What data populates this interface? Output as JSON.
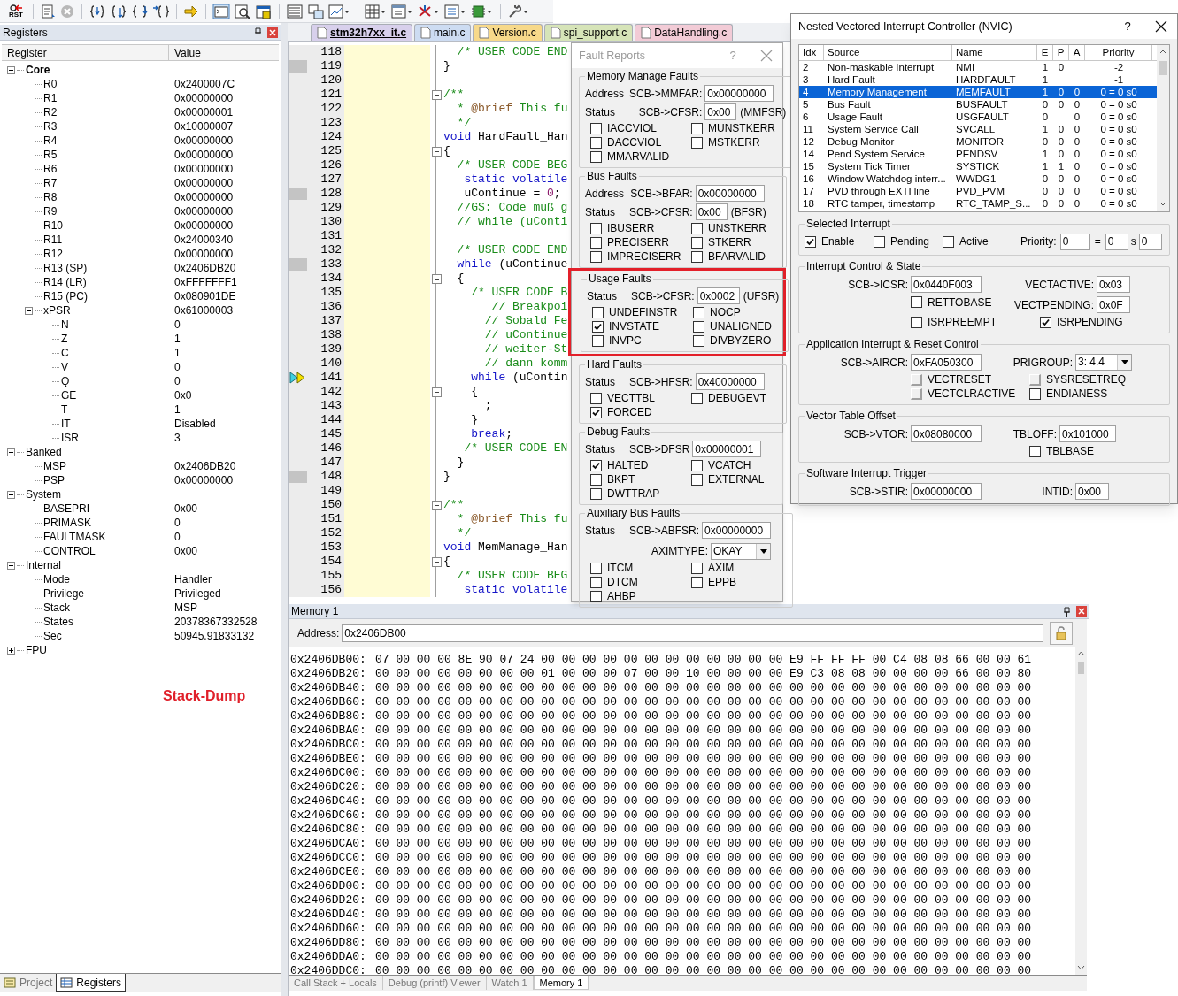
{
  "toolbar": {
    "reset_label": "RST"
  },
  "registers_panel": {
    "title": "Registers",
    "columns": [
      "Register",
      "Value"
    ],
    "tree": [
      {
        "name": "Core",
        "emphasized": true,
        "expanded": true,
        "children": [
          {
            "name": "R0",
            "value": "0x2400007C"
          },
          {
            "name": "R1",
            "value": "0x00000000"
          },
          {
            "name": "R2",
            "value": "0x00000001"
          },
          {
            "name": "R3",
            "value": "0x10000007"
          },
          {
            "name": "R4",
            "value": "0x00000000"
          },
          {
            "name": "R5",
            "value": "0x00000000"
          },
          {
            "name": "R6",
            "value": "0x00000000"
          },
          {
            "name": "R7",
            "value": "0x00000000"
          },
          {
            "name": "R8",
            "value": "0x00000000"
          },
          {
            "name": "R9",
            "value": "0x00000000"
          },
          {
            "name": "R10",
            "value": "0x00000000"
          },
          {
            "name": "R11",
            "value": "0x24000340"
          },
          {
            "name": "R12",
            "value": "0x00000000"
          },
          {
            "name": "R13 (SP)",
            "value": "0x2406DB20"
          },
          {
            "name": "R14 (LR)",
            "value": "0xFFFFFFF1"
          },
          {
            "name": "R15 (PC)",
            "value": "0x080901DE"
          },
          {
            "name": "xPSR",
            "value": "0x61000003",
            "expanded": true,
            "children": [
              {
                "name": "N",
                "value": "0"
              },
              {
                "name": "Z",
                "value": "1"
              },
              {
                "name": "C",
                "value": "1"
              },
              {
                "name": "V",
                "value": "0"
              },
              {
                "name": "Q",
                "value": "0"
              },
              {
                "name": "GE",
                "value": "0x0"
              },
              {
                "name": "T",
                "value": "1"
              },
              {
                "name": "IT",
                "value": "Disabled"
              },
              {
                "name": "ISR",
                "value": "3"
              }
            ]
          }
        ]
      },
      {
        "name": "Banked",
        "emphasized": false,
        "expanded": true,
        "children": [
          {
            "name": "MSP",
            "value": "0x2406DB20"
          },
          {
            "name": "PSP",
            "value": "0x00000000"
          }
        ]
      },
      {
        "name": "System",
        "emphasized": false,
        "expanded": true,
        "children": [
          {
            "name": "BASEPRI",
            "value": "0x00"
          },
          {
            "name": "PRIMASK",
            "value": "0"
          },
          {
            "name": "FAULTMASK",
            "value": "0"
          },
          {
            "name": "CONTROL",
            "value": "0x00"
          }
        ]
      },
      {
        "name": "Internal",
        "emphasized": false,
        "expanded": true,
        "children": [
          {
            "name": "Mode",
            "value": "Handler"
          },
          {
            "name": "Privilege",
            "value": "Privileged"
          },
          {
            "name": "Stack",
            "value": "MSP"
          },
          {
            "name": "States",
            "value": "20378367332528"
          },
          {
            "name": "Sec",
            "value": "50945.91833132"
          }
        ]
      },
      {
        "name": "FPU",
        "emphasized": false,
        "expanded": false
      }
    ],
    "annotation": "Stack-Dump",
    "tabs": [
      {
        "label": "Project",
        "selected": false
      },
      {
        "label": "Registers",
        "selected": true
      }
    ]
  },
  "editor": {
    "tabs": [
      {
        "label": "stm32h7xx_it.c",
        "selected": true,
        "color": "#d8d0ec"
      },
      {
        "label": "main.c",
        "selected": false,
        "color": "#cddcf2"
      },
      {
        "label": "Version.c",
        "selected": false,
        "color": "#f7d98a"
      },
      {
        "label": "spi_support.c",
        "selected": false,
        "color": "#d6e4b8"
      },
      {
        "label": "DataHandling.c",
        "selected": false,
        "color": "#f2cbd6"
      }
    ],
    "lines": [
      {
        "number": "118",
        "marked": false,
        "fold": false,
        "current": false,
        "segments": [
          {
            "kind": "comment",
            "text": "  /* USER CODE END"
          }
        ]
      },
      {
        "number": "119",
        "marked": true,
        "fold": false,
        "current": false,
        "segments": [
          {
            "kind": "plain",
            "text": "}"
          }
        ]
      },
      {
        "number": "120",
        "marked": false,
        "fold": false,
        "current": false
      },
      {
        "number": "121",
        "marked": false,
        "fold": true,
        "current": false,
        "segments": [
          {
            "kind": "comment",
            "text": "/**"
          }
        ]
      },
      {
        "number": "122",
        "marked": false,
        "fold": false,
        "current": false,
        "segments": [
          {
            "kind": "comment",
            "text": "  * "
          },
          {
            "kind": "tag",
            "text": "@brief"
          },
          {
            "kind": "comment",
            "text": " This fu"
          }
        ]
      },
      {
        "number": "123",
        "marked": false,
        "fold": false,
        "current": false,
        "segments": [
          {
            "kind": "comment",
            "text": "  */"
          }
        ]
      },
      {
        "number": "124",
        "marked": false,
        "fold": false,
        "current": false,
        "segments": [
          {
            "kind": "keyword",
            "text": "void"
          },
          {
            "kind": "plain",
            "text": " HardFault_Han"
          }
        ]
      },
      {
        "number": "125",
        "marked": false,
        "fold": true,
        "current": false,
        "segments": [
          {
            "kind": "plain",
            "text": "{"
          }
        ]
      },
      {
        "number": "126",
        "marked": false,
        "fold": false,
        "current": false,
        "segments": [
          {
            "kind": "comment",
            "text": "  /* USER CODE BEG"
          }
        ]
      },
      {
        "number": "127",
        "marked": false,
        "fold": false,
        "current": false,
        "segments": [
          {
            "kind": "keyword",
            "text": "   static volatile"
          }
        ]
      },
      {
        "number": "128",
        "marked": true,
        "fold": false,
        "current": false,
        "segments": [
          {
            "kind": "plain",
            "text": "   uContinue = "
          },
          {
            "kind": "number",
            "text": "0"
          },
          {
            "kind": "plain",
            "text": ";"
          }
        ]
      },
      {
        "number": "129",
        "marked": false,
        "fold": false,
        "current": false,
        "segments": [
          {
            "kind": "comment",
            "text": "  //GS: Code muß g"
          }
        ]
      },
      {
        "number": "130",
        "marked": false,
        "fold": false,
        "current": false,
        "segments": [
          {
            "kind": "comment",
            "text": "  // while (uConti"
          }
        ]
      },
      {
        "number": "131",
        "marked": false,
        "fold": false,
        "current": false
      },
      {
        "number": "132",
        "marked": false,
        "fold": false,
        "current": false,
        "segments": [
          {
            "kind": "comment",
            "text": "  /* USER CODE END"
          }
        ]
      },
      {
        "number": "133",
        "marked": true,
        "fold": false,
        "current": false,
        "segments": [
          {
            "kind": "keyword",
            "text": "  while"
          },
          {
            "kind": "plain",
            "text": " (uContinue"
          }
        ]
      },
      {
        "number": "134",
        "marked": false,
        "fold": true,
        "current": false,
        "segments": [
          {
            "kind": "plain",
            "text": "  {"
          }
        ]
      },
      {
        "number": "135",
        "marked": false,
        "fold": false,
        "current": false,
        "segments": [
          {
            "kind": "comment",
            "text": "    /* USER CODE B"
          }
        ]
      },
      {
        "number": "136",
        "marked": false,
        "fold": false,
        "current": false,
        "segments": [
          {
            "kind": "comment",
            "text": "       // Breakpoi"
          }
        ]
      },
      {
        "number": "137",
        "marked": false,
        "fold": false,
        "current": false,
        "segments": [
          {
            "kind": "comment",
            "text": "      // Sobald Fe"
          }
        ]
      },
      {
        "number": "138",
        "marked": false,
        "fold": false,
        "current": false,
        "segments": [
          {
            "kind": "comment",
            "text": "      // uContinue"
          }
        ]
      },
      {
        "number": "139",
        "marked": false,
        "fold": false,
        "current": false,
        "segments": [
          {
            "kind": "comment",
            "text": "      // weiter-St"
          }
        ]
      },
      {
        "number": "140",
        "marked": false,
        "fold": false,
        "current": false,
        "segments": [
          {
            "kind": "comment",
            "text": "      // dann komm"
          }
        ]
      },
      {
        "number": "141",
        "marked": false,
        "fold": false,
        "current": true,
        "segments": [
          {
            "kind": "keyword",
            "text": "    while"
          },
          {
            "kind": "plain",
            "text": " (uContin"
          }
        ]
      },
      {
        "number": "142",
        "marked": false,
        "fold": true,
        "current": false,
        "segments": [
          {
            "kind": "plain",
            "text": "    {"
          }
        ]
      },
      {
        "number": "143",
        "marked": false,
        "fold": false,
        "current": false,
        "segments": [
          {
            "kind": "plain",
            "text": "      ;"
          }
        ]
      },
      {
        "number": "144",
        "marked": false,
        "fold": false,
        "current": false,
        "segments": [
          {
            "kind": "plain",
            "text": "    }"
          }
        ]
      },
      {
        "number": "145",
        "marked": false,
        "fold": false,
        "current": false,
        "segments": [
          {
            "kind": "keyword",
            "text": "    break"
          },
          {
            "kind": "plain",
            "text": ";"
          }
        ]
      },
      {
        "number": "146",
        "marked": false,
        "fold": false,
        "current": false,
        "segments": [
          {
            "kind": "comment",
            "text": "   /* USER CODE EN"
          }
        ]
      },
      {
        "number": "147",
        "marked": false,
        "fold": false,
        "current": false,
        "segments": [
          {
            "kind": "plain",
            "text": "  }"
          }
        ]
      },
      {
        "number": "148",
        "marked": true,
        "fold": false,
        "current": false,
        "segments": [
          {
            "kind": "plain",
            "text": "}"
          }
        ]
      },
      {
        "number": "149",
        "marked": false,
        "fold": false,
        "current": false
      },
      {
        "number": "150",
        "marked": false,
        "fold": true,
        "current": false,
        "segments": [
          {
            "kind": "comment",
            "text": "/**"
          }
        ]
      },
      {
        "number": "151",
        "marked": false,
        "fold": false,
        "current": false,
        "segments": [
          {
            "kind": "comment",
            "text": "  * "
          },
          {
            "kind": "tag",
            "text": "@brief"
          },
          {
            "kind": "comment",
            "text": " This fu"
          }
        ]
      },
      {
        "number": "152",
        "marked": false,
        "fold": false,
        "current": false,
        "segments": [
          {
            "kind": "comment",
            "text": "  */"
          }
        ]
      },
      {
        "number": "153",
        "marked": false,
        "fold": false,
        "current": false,
        "segments": [
          {
            "kind": "keyword",
            "text": "void"
          },
          {
            "kind": "plain",
            "text": " MemManage_Han"
          }
        ]
      },
      {
        "number": "154",
        "marked": false,
        "fold": true,
        "current": false,
        "segments": [
          {
            "kind": "plain",
            "text": "{"
          }
        ]
      },
      {
        "number": "155",
        "marked": false,
        "fold": false,
        "current": false,
        "segments": [
          {
            "kind": "comment",
            "text": "  /* USER CODE BEG"
          }
        ]
      },
      {
        "number": "156",
        "marked": false,
        "fold": false,
        "current": false,
        "segments": [
          {
            "kind": "keyword",
            "text": "   static volatile"
          }
        ]
      }
    ]
  },
  "memory": {
    "title": "Memory 1",
    "address_label": "Address:",
    "address": "0x2406DB00",
    "rows": [
      {
        "address": "0x2406DB00:",
        "bytes": "07 00 00 00 8E 90 07 24 00 00 00 00 00 00 00 00 00 00 00 00 E9 FF FF FF 00 C4 08 08 66 00 00 61"
      },
      {
        "address": "0x2406DB20:",
        "bytes": "00 00 00 00 00 00 00 00 01 00 00 00 07 00 00 10 00 00 00 00 E9 C3 08 08 00 00 00 00 66 00 00 80"
      },
      {
        "address": "0x2406DB40:",
        "bytes": "00 00 00 00 00 00 00 00 00 00 00 00 00 00 00 00 00 00 00 00 00 00 00 00 00 00 00 00 00 00 00 00"
      },
      {
        "address": "0x2406DB60:",
        "bytes": "00 00 00 00 00 00 00 00 00 00 00 00 00 00 00 00 00 00 00 00 00 00 00 00 00 00 00 00 00 00 00 00"
      },
      {
        "address": "0x2406DB80:",
        "bytes": "00 00 00 00 00 00 00 00 00 00 00 00 00 00 00 00 00 00 00 00 00 00 00 00 00 00 00 00 00 00 00 00"
      },
      {
        "address": "0x2406DBA0:",
        "bytes": "00 00 00 00 00 00 00 00 00 00 00 00 00 00 00 00 00 00 00 00 00 00 00 00 00 00 00 00 00 00 00 00"
      },
      {
        "address": "0x2406DBC0:",
        "bytes": "00 00 00 00 00 00 00 00 00 00 00 00 00 00 00 00 00 00 00 00 00 00 00 00 00 00 00 00 00 00 00 00"
      },
      {
        "address": "0x2406DBE0:",
        "bytes": "00 00 00 00 00 00 00 00 00 00 00 00 00 00 00 00 00 00 00 00 00 00 00 00 00 00 00 00 00 00 00 00"
      },
      {
        "address": "0x2406DC00:",
        "bytes": "00 00 00 00 00 00 00 00 00 00 00 00 00 00 00 00 00 00 00 00 00 00 00 00 00 00 00 00 00 00 00 00"
      },
      {
        "address": "0x2406DC20:",
        "bytes": "00 00 00 00 00 00 00 00 00 00 00 00 00 00 00 00 00 00 00 00 00 00 00 00 00 00 00 00 00 00 00 00"
      },
      {
        "address": "0x2406DC40:",
        "bytes": "00 00 00 00 00 00 00 00 00 00 00 00 00 00 00 00 00 00 00 00 00 00 00 00 00 00 00 00 00 00 00 00"
      },
      {
        "address": "0x2406DC60:",
        "bytes": "00 00 00 00 00 00 00 00 00 00 00 00 00 00 00 00 00 00 00 00 00 00 00 00 00 00 00 00 00 00 00 00"
      },
      {
        "address": "0x2406DC80:",
        "bytes": "00 00 00 00 00 00 00 00 00 00 00 00 00 00 00 00 00 00 00 00 00 00 00 00 00 00 00 00 00 00 00 00"
      },
      {
        "address": "0x2406DCA0:",
        "bytes": "00 00 00 00 00 00 00 00 00 00 00 00 00 00 00 00 00 00 00 00 00 00 00 00 00 00 00 00 00 00 00 00"
      },
      {
        "address": "0x2406DCC0:",
        "bytes": "00 00 00 00 00 00 00 00 00 00 00 00 00 00 00 00 00 00 00 00 00 00 00 00 00 00 00 00 00 00 00 00"
      },
      {
        "address": "0x2406DCE0:",
        "bytes": "00 00 00 00 00 00 00 00 00 00 00 00 00 00 00 00 00 00 00 00 00 00 00 00 00 00 00 00 00 00 00 00"
      },
      {
        "address": "0x2406DD00:",
        "bytes": "00 00 00 00 00 00 00 00 00 00 00 00 00 00 00 00 00 00 00 00 00 00 00 00 00 00 00 00 00 00 00 00"
      },
      {
        "address": "0x2406DD20:",
        "bytes": "00 00 00 00 00 00 00 00 00 00 00 00 00 00 00 00 00 00 00 00 00 00 00 00 00 00 00 00 00 00 00 00"
      },
      {
        "address": "0x2406DD40:",
        "bytes": "00 00 00 00 00 00 00 00 00 00 00 00 00 00 00 00 00 00 00 00 00 00 00 00 00 00 00 00 00 00 00 00"
      },
      {
        "address": "0x2406DD60:",
        "bytes": "00 00 00 00 00 00 00 00 00 00 00 00 00 00 00 00 00 00 00 00 00 00 00 00 00 00 00 00 00 00 00 00"
      },
      {
        "address": "0x2406DD80:",
        "bytes": "00 00 00 00 00 00 00 00 00 00 00 00 00 00 00 00 00 00 00 00 00 00 00 00 00 00 00 00 00 00 00 00"
      },
      {
        "address": "0x2406DDA0:",
        "bytes": "00 00 00 00 00 00 00 00 00 00 00 00 00 00 00 00 00 00 00 00 00 00 00 00 00 00 00 00 00 00 00 00"
      },
      {
        "address": "0x2406DDC0:",
        "bytes": "00 00 00 00 00 00 00 00 00 00 00 00 00 00 00 00 00 00 00 00 00 00 00 00 00 00 00 00 00 00 00 00"
      }
    ],
    "tabs": [
      {
        "label": "Call Stack + Locals",
        "selected": false
      },
      {
        "label": "Debug (printf) Viewer",
        "selected": false
      },
      {
        "label": "Watch 1",
        "selected": false
      },
      {
        "label": "Memory 1",
        "selected": true
      }
    ]
  },
  "fault_reports": {
    "title": "Fault Reports",
    "help": "?",
    "sections": [
      {
        "title": "Memory Manage Faults",
        "highlighted": false,
        "fields": [
          {
            "label": "Address",
            "register": "SCB->MMFAR:",
            "value": "0x00000000"
          },
          {
            "label": "Status",
            "register": "SCB->CFSR:",
            "value": "0x00",
            "suffix": "(MMFSR)"
          }
        ],
        "flags": [
          {
            "label": "IACCVIOL",
            "checked": false
          },
          {
            "label": "MUNSTKERR",
            "checked": false
          },
          {
            "label": "DACCVIOL",
            "checked": false
          },
          {
            "label": "MSTKERR",
            "checked": false
          },
          {
            "label": "MMARVALID",
            "checked": false
          }
        ]
      },
      {
        "title": "Bus Faults",
        "highlighted": false,
        "fields": [
          {
            "label": "Address",
            "register": "SCB->BFAR:",
            "value": "0x00000000"
          },
          {
            "label": "Status",
            "register": "SCB->CFSR:",
            "value": "0x00",
            "suffix": "(BFSR)"
          }
        ],
        "flags": [
          {
            "label": "IBUSERR",
            "checked": false
          },
          {
            "label": "UNSTKERR",
            "checked": false
          },
          {
            "label": "PRECISERR",
            "checked": false
          },
          {
            "label": "STKERR",
            "checked": false
          },
          {
            "label": "IMPRECISERR",
            "checked": false
          },
          {
            "label": "BFARVALID",
            "checked": false
          }
        ]
      },
      {
        "title": "Usage Faults",
        "highlighted": true,
        "fields": [
          {
            "label": "Status",
            "register": "SCB->CFSR:",
            "value": "0x0002",
            "suffix": "(UFSR)"
          }
        ],
        "flags": [
          {
            "label": "UNDEFINSTR",
            "checked": false
          },
          {
            "label": "NOCP",
            "checked": false
          },
          {
            "label": "INVSTATE",
            "checked": true
          },
          {
            "label": "UNALIGNED",
            "checked": false
          },
          {
            "label": "INVPC",
            "checked": false
          },
          {
            "label": "DIVBYZERO",
            "checked": false
          }
        ]
      },
      {
        "title": "Hard Faults",
        "highlighted": false,
        "fields": [
          {
            "label": "Status",
            "register": "SCB->HFSR:",
            "value": "0x40000000"
          }
        ],
        "flags": [
          {
            "label": "VECTTBL",
            "checked": false
          },
          {
            "label": "DEBUGEVT",
            "checked": false
          },
          {
            "label": "FORCED",
            "checked": true
          }
        ]
      },
      {
        "title": "Debug Faults",
        "highlighted": false,
        "fields": [
          {
            "label": "Status",
            "register": "SCB->DFSR",
            "value": "0x00000001"
          }
        ],
        "flags": [
          {
            "label": "HALTED",
            "checked": true
          },
          {
            "label": "VCATCH",
            "checked": false
          },
          {
            "label": "BKPT",
            "checked": false
          },
          {
            "label": "EXTERNAL",
            "checked": false
          },
          {
            "label": "DWTTRAP",
            "checked": false
          }
        ]
      },
      {
        "title": "Auxiliary Bus Faults",
        "highlighted": false,
        "fields": [
          {
            "label": "Status",
            "register": "SCB->ABFSR:",
            "value": "0x00000000"
          }
        ],
        "dropdown": {
          "label": "AXIMTYPE:",
          "value": "OKAY"
        },
        "flags": [
          {
            "label": "ITCM",
            "checked": false
          },
          {
            "label": "AXIM",
            "checked": false
          },
          {
            "label": "DTCM",
            "checked": false
          },
          {
            "label": "EPPB",
            "checked": false
          },
          {
            "label": "AHBP",
            "checked": false
          }
        ]
      }
    ]
  },
  "nvic": {
    "title": "Nested Vectored Interrupt Controller (NVIC)",
    "help": "?",
    "columns": [
      "Idx",
      "Source",
      "Name",
      "E",
      "P",
      "A",
      "Priority"
    ],
    "rows": [
      {
        "idx": "2",
        "source": "Non-maskable Interrupt",
        "name": "NMI",
        "e": "1",
        "p": "0",
        "priority": "-2",
        "selected": false
      },
      {
        "idx": "3",
        "source": "Hard Fault",
        "name": "HARDFAULT",
        "e": "1",
        "priority": "-1",
        "selected": false
      },
      {
        "idx": "4",
        "source": "Memory Management",
        "name": "MEMFAULT",
        "e": "1",
        "p": "0",
        "a": "0",
        "priority": "0 = 0 s0",
        "selected": true
      },
      {
        "idx": "5",
        "source": "Bus Fault",
        "name": "BUSFAULT",
        "e": "0",
        "p": "0",
        "a": "0",
        "priority": "0 = 0 s0",
        "selected": false
      },
      {
        "idx": "6",
        "source": "Usage Fault",
        "name": "USGFAULT",
        "e": "0",
        "a": "0",
        "priority": "0 = 0 s0",
        "selected": false
      },
      {
        "idx": "11",
        "source": "System Service Call",
        "name": "SVCALL",
        "e": "1",
        "p": "0",
        "a": "0",
        "priority": "0 = 0 s0",
        "selected": false
      },
      {
        "idx": "12",
        "source": "Debug Monitor",
        "name": "MONITOR",
        "e": "0",
        "p": "0",
        "a": "0",
        "priority": "0 = 0 s0",
        "selected": false
      },
      {
        "idx": "14",
        "source": "Pend System Service",
        "name": "PENDSV",
        "e": "1",
        "p": "0",
        "a": "0",
        "priority": "0 = 0 s0",
        "selected": false
      },
      {
        "idx": "15",
        "source": "System Tick Timer",
        "name": "SYSTICK",
        "e": "1",
        "p": "1",
        "a": "0",
        "priority": "0 = 0 s0",
        "selected": false
      },
      {
        "idx": "16",
        "source": "Window Watchdog interr...",
        "name": "WWDG1",
        "e": "0",
        "p": "0",
        "a": "0",
        "priority": "0 = 0 s0",
        "selected": false
      },
      {
        "idx": "17",
        "source": "PVD through EXTI line",
        "name": "PVD_PVM",
        "e": "0",
        "p": "0",
        "a": "0",
        "priority": "0 = 0 s0",
        "selected": false
      },
      {
        "idx": "18",
        "source": "RTC tamper, timestamp",
        "name": "RTC_TAMP_S...",
        "e": "0",
        "p": "0",
        "a": "0",
        "priority": "0 = 0 s0",
        "selected": false
      }
    ],
    "selected_interrupt": {
      "title": "Selected Interrupt",
      "flags": [
        {
          "label": "Enable",
          "checked": true
        },
        {
          "label": "Pending",
          "checked": false
        },
        {
          "label": "Active",
          "checked": false
        }
      ],
      "priority_label": "Priority:",
      "priority": "0",
      "equals": "=",
      "group_priority": "0",
      "sub_label": "s",
      "sub_priority": "0"
    },
    "interrupt_control": {
      "title": "Interrupt Control & State",
      "register": "SCB->ICSR:",
      "value": "0x0440F003",
      "vectactive_label": "VECTACTIVE:",
      "vectactive": "0x03",
      "vectpending_label": "VECTPENDING:",
      "vectpending": "0x0F",
      "flags": [
        {
          "label": "RETTOBASE",
          "checked": false
        },
        {
          "label": "ISRPREEMPT",
          "checked": false
        },
        {
          "label": "ISRPENDING",
          "checked": true
        }
      ]
    },
    "app_control": {
      "title": "Application Interrupt & Reset Control",
      "register": "SCB->AIRCR:",
      "value": "0xFA050300",
      "prigroup_label": "PRIGROUP:",
      "prigroup": "3: 4.4",
      "flags": [
        {
          "label": "VECTRESET",
          "checked": false,
          "disabled": true
        },
        {
          "label": "SYSRESETREQ",
          "checked": false,
          "disabled": true
        },
        {
          "label": "VECTCLRACTIVE",
          "checked": false,
          "disabled": true
        },
        {
          "label": "ENDIANESS",
          "checked": false,
          "disabled": false
        }
      ]
    },
    "vector_table": {
      "title": "Vector Table Offset",
      "register": "SCB->VTOR:",
      "value": "0x08080000",
      "tbloff_label": "TBLOFF:",
      "tbloff": "0x101000",
      "flags": [
        {
          "label": "TBLBASE",
          "checked": false
        }
      ]
    },
    "software_trigger": {
      "title": "Software Interrupt Trigger",
      "register": "SCB->STIR:",
      "value": "0x00000000",
      "intid_label": "INTID:",
      "intid": "0x00"
    }
  }
}
